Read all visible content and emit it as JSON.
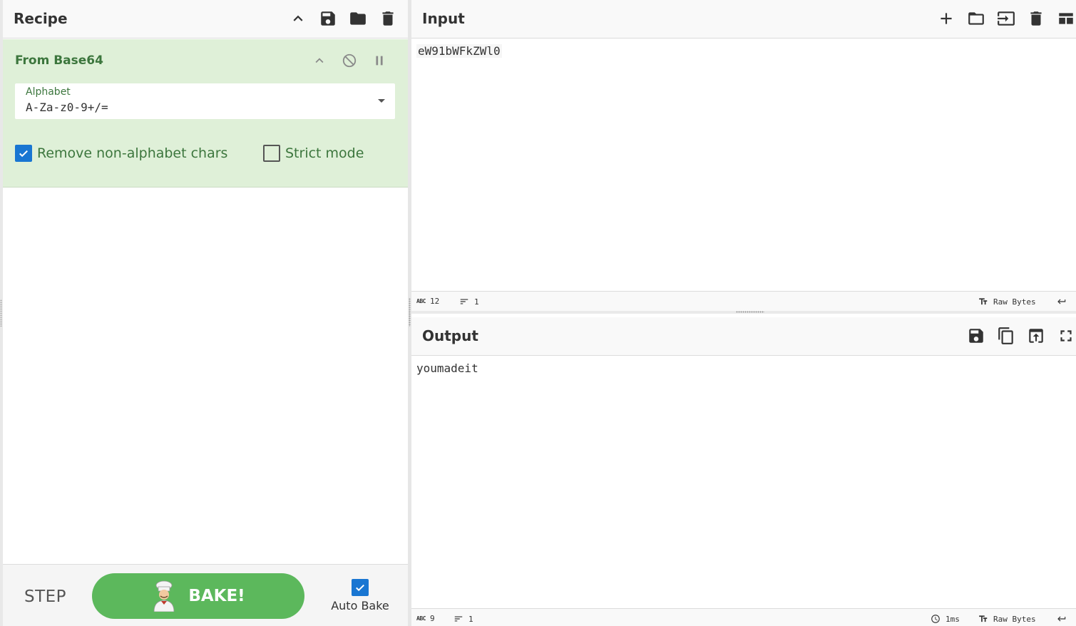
{
  "recipe": {
    "title": "Recipe",
    "icons": [
      "chevron-up-icon",
      "save-icon",
      "folder-icon",
      "trash-icon"
    ]
  },
  "operation": {
    "name": "From Base64",
    "alphabet_label": "Alphabet",
    "alphabet_value": "A-Za-z0-9+/=",
    "remove_non_alpha": {
      "label": "Remove non-alphabet chars",
      "checked": true
    },
    "strict_mode": {
      "label": "Strict mode",
      "checked": false
    }
  },
  "controls": {
    "step_label": "STEP",
    "bake_label": "BAKE!",
    "auto_bake_label": "Auto Bake",
    "auto_bake_checked": true
  },
  "input": {
    "title": "Input",
    "text": "eW91bWFkZWl0",
    "status": {
      "abc_label": "ABC",
      "chars": "12",
      "lines": "1",
      "encoding": "Raw Bytes"
    }
  },
  "output": {
    "title": "Output",
    "text": "youmadeit",
    "status": {
      "abc_label": "ABC",
      "chars": "9",
      "lines": "1",
      "time": "1ms",
      "encoding": "Raw Bytes"
    }
  },
  "colors": {
    "operation_bg": "#dff0d8",
    "operation_text": "#3c763d",
    "bake_button": "#5cb85c",
    "checkbox_on": "#1976d2"
  }
}
